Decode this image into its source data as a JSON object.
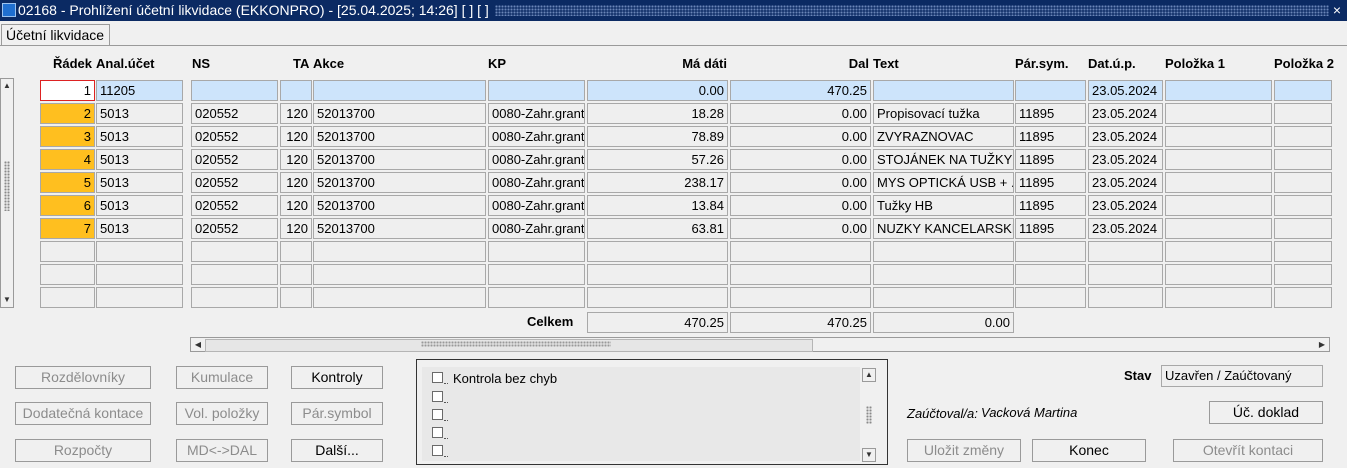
{
  "window": {
    "title": "02168 - Prohlížení účetní likvidace (EKKONPRO) - [25.04.2025; 14:26]  [ ]  [ ]",
    "close_glyph": "×"
  },
  "tab": {
    "label": "Účetní likvidace"
  },
  "columns": [
    "Řádek",
    "Anal.účet",
    "NS",
    "TA",
    "Akce",
    "KP",
    "Má dáti",
    "Dal",
    "Text",
    "Pár.sym.",
    "Dat.ú.p.",
    "Položka 1",
    "Položka 2"
  ],
  "rows": [
    {
      "radek": "1",
      "anal": "11205",
      "ns": "",
      "ta": "",
      "akce": "",
      "kp": "",
      "madati": "0.00",
      "dal": "470.25",
      "text": "",
      "parsym": "",
      "datup": "23.05.2024",
      "pol1": "",
      "pol2": ""
    },
    {
      "radek": "2",
      "anal": "5013",
      "ns": "020552",
      "ta": "120",
      "akce": "52013700",
      "kp": "0080-Zahr.granty",
      "madati": "18.28",
      "dal": "0.00",
      "text": "Propisovací tužka",
      "parsym": "11895",
      "datup": "23.05.2024",
      "pol1": "",
      "pol2": ""
    },
    {
      "radek": "3",
      "anal": "5013",
      "ns": "020552",
      "ta": "120",
      "akce": "52013700",
      "kp": "0080-Zahr.granty",
      "madati": "78.89",
      "dal": "0.00",
      "text": "ZVYRAZNOVAC",
      "parsym": "11895",
      "datup": "23.05.2024",
      "pol1": "",
      "pol2": ""
    },
    {
      "radek": "4",
      "anal": "5013",
      "ns": "020552",
      "ta": "120",
      "akce": "52013700",
      "kp": "0080-Zahr.granty",
      "madati": "57.26",
      "dal": "0.00",
      "text": "STOJÁNEK NA TUŽKY",
      "parsym": "11895",
      "datup": "23.05.2024",
      "pol1": "",
      "pol2": ""
    },
    {
      "radek": "5",
      "anal": "5013",
      "ns": "020552",
      "ta": "120",
      "akce": "52013700",
      "kp": "0080-Zahr.granty",
      "madati": "238.17",
      "dal": "0.00",
      "text": "MYS OPTICKÁ USB + ...",
      "parsym": "11895",
      "datup": "23.05.2024",
      "pol1": "",
      "pol2": ""
    },
    {
      "radek": "6",
      "anal": "5013",
      "ns": "020552",
      "ta": "120",
      "akce": "52013700",
      "kp": "0080-Zahr.granty",
      "madati": "13.84",
      "dal": "0.00",
      "text": "Tužky HB",
      "parsym": "11895",
      "datup": "23.05.2024",
      "pol1": "",
      "pol2": ""
    },
    {
      "radek": "7",
      "anal": "5013",
      "ns": "020552",
      "ta": "120",
      "akce": "52013700",
      "kp": "0080-Zahr.granty",
      "madati": "63.81",
      "dal": "0.00",
      "text": "NUZKY KANCELARSKE",
      "parsym": "11895",
      "datup": "23.05.2024",
      "pol1": "",
      "pol2": ""
    },
    {
      "radek": "",
      "anal": "",
      "ns": "",
      "ta": "",
      "akce": "",
      "kp": "",
      "madati": "",
      "dal": "",
      "text": "",
      "parsym": "",
      "datup": "",
      "pol1": "",
      "pol2": ""
    },
    {
      "radek": "",
      "anal": "",
      "ns": "",
      "ta": "",
      "akce": "",
      "kp": "",
      "madati": "",
      "dal": "",
      "text": "",
      "parsym": "",
      "datup": "",
      "pol1": "",
      "pol2": ""
    },
    {
      "radek": "",
      "anal": "",
      "ns": "",
      "ta": "",
      "akce": "",
      "kp": "",
      "madati": "",
      "dal": "",
      "text": "",
      "parsym": "",
      "datup": "",
      "pol1": "",
      "pol2": ""
    }
  ],
  "totals": {
    "label": "Celkem",
    "madati": "470.25",
    "dal": "470.25",
    "diff": "0.00"
  },
  "buttons": {
    "rozdelovniky": "Rozdělovníky",
    "kumulace": "Kumulace",
    "kontroly": "Kontroly",
    "dodatecna_kontace": "Dodatečná kontace",
    "vol_polozky": "Vol. položky",
    "par_symbol": "Pár.symbol",
    "rozpocty": "Rozpočty",
    "md_dal": "MD<->DAL",
    "dalsi": "Další...",
    "uc_doklad": "Úč. doklad",
    "ulozit_zmeny": "Uložit změny",
    "konec": "Konec",
    "otevrit_kontaci": "Otevřít kontaci"
  },
  "checks": [
    "Kontrola bez chyb",
    "",
    "",
    "",
    ""
  ],
  "status": {
    "label": "Stav",
    "value": "Uzavřen / Zaúčtovaný"
  },
  "accountant": {
    "label": "Zaúčtoval/a:",
    "value": "Vacková Martina"
  },
  "colors": {
    "title_bar": "#0b2a63",
    "selected_row": "#cde4fb",
    "row_marker": "#ffbf1f"
  },
  "icons": {
    "app": "app-icon",
    "close": "close-icon",
    "scroll_up": "scroll-up-icon",
    "scroll_down": "scroll-down-icon",
    "scroll_left": "scroll-left-icon",
    "scroll_right": "scroll-right-icon"
  }
}
